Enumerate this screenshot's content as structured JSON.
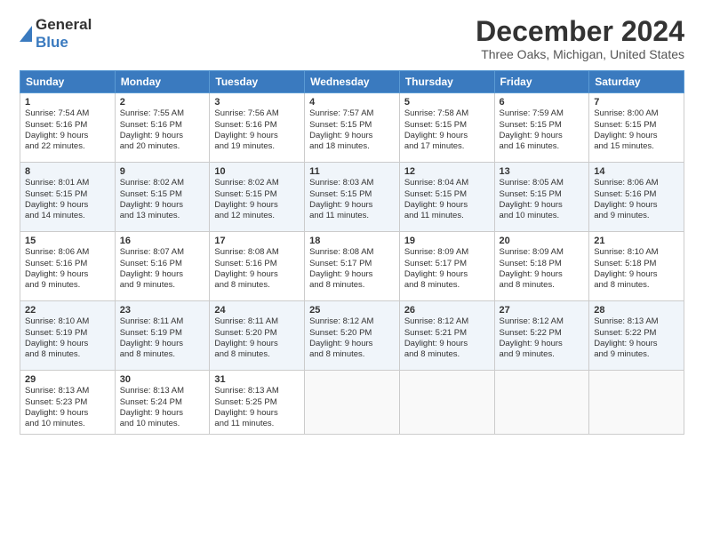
{
  "header": {
    "logo_general": "General",
    "logo_blue": "Blue",
    "month_title": "December 2024",
    "location": "Three Oaks, Michigan, United States"
  },
  "weekdays": [
    "Sunday",
    "Monday",
    "Tuesday",
    "Wednesday",
    "Thursday",
    "Friday",
    "Saturday"
  ],
  "weeks": [
    [
      {
        "day": "1",
        "lines": [
          "Sunrise: 7:54 AM",
          "Sunset: 5:16 PM",
          "Daylight: 9 hours",
          "and 22 minutes."
        ]
      },
      {
        "day": "2",
        "lines": [
          "Sunrise: 7:55 AM",
          "Sunset: 5:16 PM",
          "Daylight: 9 hours",
          "and 20 minutes."
        ]
      },
      {
        "day": "3",
        "lines": [
          "Sunrise: 7:56 AM",
          "Sunset: 5:16 PM",
          "Daylight: 9 hours",
          "and 19 minutes."
        ]
      },
      {
        "day": "4",
        "lines": [
          "Sunrise: 7:57 AM",
          "Sunset: 5:15 PM",
          "Daylight: 9 hours",
          "and 18 minutes."
        ]
      },
      {
        "day": "5",
        "lines": [
          "Sunrise: 7:58 AM",
          "Sunset: 5:15 PM",
          "Daylight: 9 hours",
          "and 17 minutes."
        ]
      },
      {
        "day": "6",
        "lines": [
          "Sunrise: 7:59 AM",
          "Sunset: 5:15 PM",
          "Daylight: 9 hours",
          "and 16 minutes."
        ]
      },
      {
        "day": "7",
        "lines": [
          "Sunrise: 8:00 AM",
          "Sunset: 5:15 PM",
          "Daylight: 9 hours",
          "and 15 minutes."
        ]
      }
    ],
    [
      {
        "day": "8",
        "lines": [
          "Sunrise: 8:01 AM",
          "Sunset: 5:15 PM",
          "Daylight: 9 hours",
          "and 14 minutes."
        ]
      },
      {
        "day": "9",
        "lines": [
          "Sunrise: 8:02 AM",
          "Sunset: 5:15 PM",
          "Daylight: 9 hours",
          "and 13 minutes."
        ]
      },
      {
        "day": "10",
        "lines": [
          "Sunrise: 8:02 AM",
          "Sunset: 5:15 PM",
          "Daylight: 9 hours",
          "and 12 minutes."
        ]
      },
      {
        "day": "11",
        "lines": [
          "Sunrise: 8:03 AM",
          "Sunset: 5:15 PM",
          "Daylight: 9 hours",
          "and 11 minutes."
        ]
      },
      {
        "day": "12",
        "lines": [
          "Sunrise: 8:04 AM",
          "Sunset: 5:15 PM",
          "Daylight: 9 hours",
          "and 11 minutes."
        ]
      },
      {
        "day": "13",
        "lines": [
          "Sunrise: 8:05 AM",
          "Sunset: 5:15 PM",
          "Daylight: 9 hours",
          "and 10 minutes."
        ]
      },
      {
        "day": "14",
        "lines": [
          "Sunrise: 8:06 AM",
          "Sunset: 5:16 PM",
          "Daylight: 9 hours",
          "and 9 minutes."
        ]
      }
    ],
    [
      {
        "day": "15",
        "lines": [
          "Sunrise: 8:06 AM",
          "Sunset: 5:16 PM",
          "Daylight: 9 hours",
          "and 9 minutes."
        ]
      },
      {
        "day": "16",
        "lines": [
          "Sunrise: 8:07 AM",
          "Sunset: 5:16 PM",
          "Daylight: 9 hours",
          "and 9 minutes."
        ]
      },
      {
        "day": "17",
        "lines": [
          "Sunrise: 8:08 AM",
          "Sunset: 5:16 PM",
          "Daylight: 9 hours",
          "and 8 minutes."
        ]
      },
      {
        "day": "18",
        "lines": [
          "Sunrise: 8:08 AM",
          "Sunset: 5:17 PM",
          "Daylight: 9 hours",
          "and 8 minutes."
        ]
      },
      {
        "day": "19",
        "lines": [
          "Sunrise: 8:09 AM",
          "Sunset: 5:17 PM",
          "Daylight: 9 hours",
          "and 8 minutes."
        ]
      },
      {
        "day": "20",
        "lines": [
          "Sunrise: 8:09 AM",
          "Sunset: 5:18 PM",
          "Daylight: 9 hours",
          "and 8 minutes."
        ]
      },
      {
        "day": "21",
        "lines": [
          "Sunrise: 8:10 AM",
          "Sunset: 5:18 PM",
          "Daylight: 9 hours",
          "and 8 minutes."
        ]
      }
    ],
    [
      {
        "day": "22",
        "lines": [
          "Sunrise: 8:10 AM",
          "Sunset: 5:19 PM",
          "Daylight: 9 hours",
          "and 8 minutes."
        ]
      },
      {
        "day": "23",
        "lines": [
          "Sunrise: 8:11 AM",
          "Sunset: 5:19 PM",
          "Daylight: 9 hours",
          "and 8 minutes."
        ]
      },
      {
        "day": "24",
        "lines": [
          "Sunrise: 8:11 AM",
          "Sunset: 5:20 PM",
          "Daylight: 9 hours",
          "and 8 minutes."
        ]
      },
      {
        "day": "25",
        "lines": [
          "Sunrise: 8:12 AM",
          "Sunset: 5:20 PM",
          "Daylight: 9 hours",
          "and 8 minutes."
        ]
      },
      {
        "day": "26",
        "lines": [
          "Sunrise: 8:12 AM",
          "Sunset: 5:21 PM",
          "Daylight: 9 hours",
          "and 8 minutes."
        ]
      },
      {
        "day": "27",
        "lines": [
          "Sunrise: 8:12 AM",
          "Sunset: 5:22 PM",
          "Daylight: 9 hours",
          "and 9 minutes."
        ]
      },
      {
        "day": "28",
        "lines": [
          "Sunrise: 8:13 AM",
          "Sunset: 5:22 PM",
          "Daylight: 9 hours",
          "and 9 minutes."
        ]
      }
    ],
    [
      {
        "day": "29",
        "lines": [
          "Sunrise: 8:13 AM",
          "Sunset: 5:23 PM",
          "Daylight: 9 hours",
          "and 10 minutes."
        ]
      },
      {
        "day": "30",
        "lines": [
          "Sunrise: 8:13 AM",
          "Sunset: 5:24 PM",
          "Daylight: 9 hours",
          "and 10 minutes."
        ]
      },
      {
        "day": "31",
        "lines": [
          "Sunrise: 8:13 AM",
          "Sunset: 5:25 PM",
          "Daylight: 9 hours",
          "and 11 minutes."
        ]
      },
      {
        "day": "",
        "lines": []
      },
      {
        "day": "",
        "lines": []
      },
      {
        "day": "",
        "lines": []
      },
      {
        "day": "",
        "lines": []
      }
    ]
  ]
}
